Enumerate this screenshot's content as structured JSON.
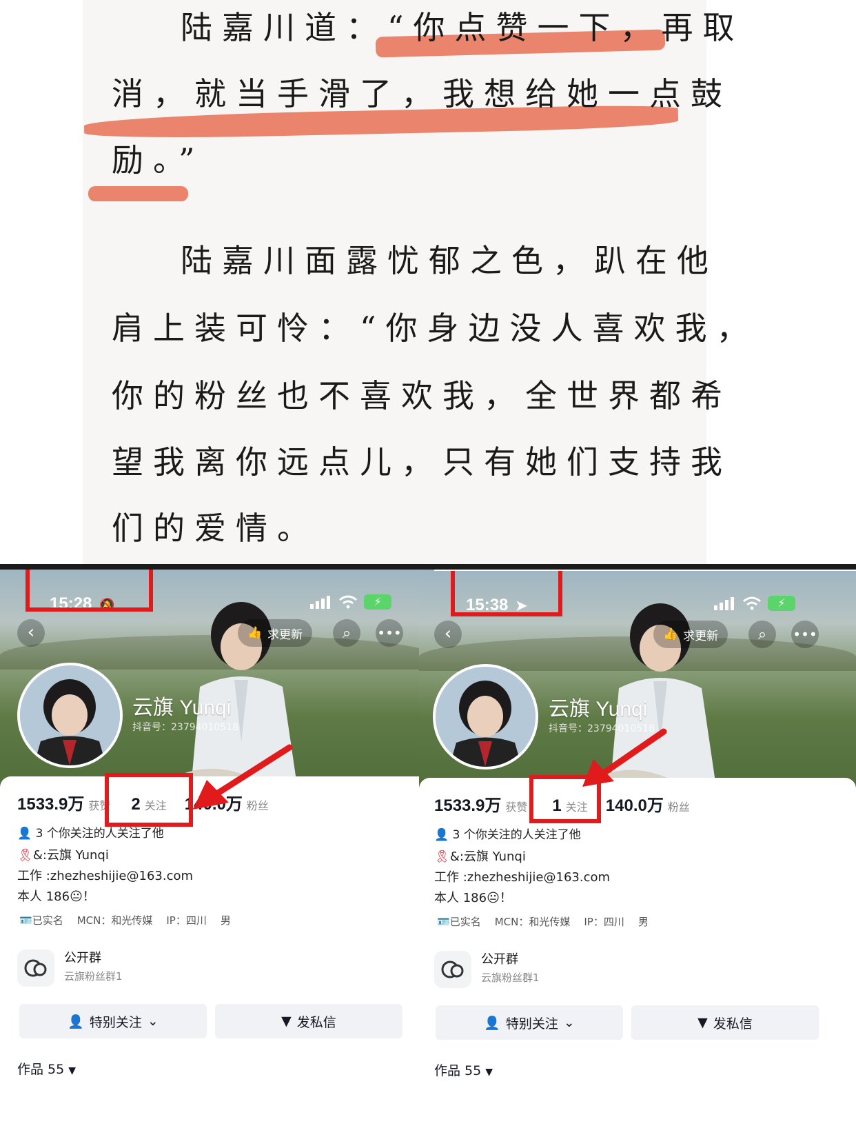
{
  "text_panel": {
    "lines": [
      "陆嘉川道：“你点赞一下，再取",
      "消，就当手滑了，我想给她一点鼓",
      "励。”",
      "陆嘉川面露忧郁之色，趴在他",
      "肩上装可怜：“你身边没人喜欢我，",
      "你的粉丝也不喜欢我，全世界都希",
      "望我离你远点儿，只有她们支持我",
      "们的爱情。"
    ],
    "highlight_color": "#e8795f"
  },
  "phones": [
    {
      "time": "15:28",
      "status_icon": "mute-bell-icon",
      "update_label": "求更新",
      "name": "云旗 Yunqi",
      "douyin_id": "抖音号：2379401051​8",
      "likes_num": "1533.9万",
      "likes_label": "获赞",
      "following_num": "2",
      "following_label": "关注",
      "fans_num": "140.0万",
      "fans_label": "粉丝",
      "mutual": "3 个你关注的人关注了他",
      "bio1": "&:云旗 Yunqi",
      "bio2": "工作 :zhezheshijie@163.com",
      "bio3": "本人 186😐！",
      "verified": "已实名",
      "mcn": "MCN：和光传媒",
      "ip": "IP：四川",
      "gender": "男",
      "group_title": "公开群",
      "group_sub": "云旗粉丝群1",
      "special_follow": "特别关注",
      "message": "发私信",
      "works": "作品 55"
    },
    {
      "time": "15:38",
      "status_icon": "location-arrow-icon",
      "update_label": "求更新",
      "name": "云旗 Yunqi",
      "douyin_id": "抖音号：2379401051​8",
      "likes_num": "1533.9万",
      "likes_label": "获赞",
      "following_num": "1",
      "following_label": "关注",
      "fans_num": "140.0万",
      "fans_label": "粉丝",
      "mutual": "3 个你关注的人关注了他",
      "bio1": "&:云旗 Yunqi",
      "bio2": "工作 :zhezheshijie@163.com",
      "bio3": "本人 186😐！",
      "verified": "已实名",
      "mcn": "MCN：和光传媒",
      "ip": "IP：四川",
      "gender": "男",
      "group_title": "公开群",
      "group_sub": "云旗粉丝群1",
      "special_follow": "特别关注",
      "message": "发私信",
      "works": "作品 55"
    }
  ],
  "accent_red": "#e11b1b"
}
